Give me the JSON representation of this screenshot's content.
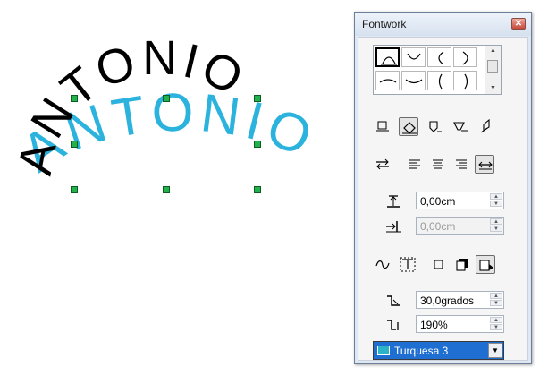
{
  "canvas": {
    "shadow_text": "ANTONIO",
    "main_text": "ANTONIO",
    "shadow_color": "#2bb3dd",
    "text_color": "#000000",
    "handle_color": "#22b14c"
  },
  "window": {
    "title": "Fontwork",
    "close_glyph": "✕"
  },
  "gallery": {
    "shapes": [
      "upper-arc",
      "lower-arc",
      "left-arc",
      "right-arc",
      "upper-arc-open",
      "lower-arc-open",
      "left-arc-open",
      "right-arc-open"
    ],
    "selected_index": 0,
    "scroll_up": "▲",
    "scroll_down": "▼"
  },
  "toolbar_orientation": {
    "buttons": [
      "off-icon",
      "rotate-icon",
      "upright-icon",
      "slant-horizontal-icon",
      "slant-vertical-icon"
    ],
    "active": "rotate-icon"
  },
  "toolbar_alignment": {
    "buttons": [
      "orientation-icon",
      "align-left-icon",
      "align-center-icon",
      "align-right-icon",
      "autosize-icon"
    ],
    "active": "autosize-icon"
  },
  "distance": {
    "value": "0,00cm"
  },
  "indent": {
    "value": "0,00cm",
    "disabled": true
  },
  "toolbar_contour": {
    "buttons": [
      "contour-icon",
      "text-frame-icon",
      "shadow-off-icon",
      "shadow-vertical-icon",
      "shadow-slant-icon"
    ],
    "active": "shadow-slant-icon"
  },
  "shadow_angle": {
    "value": "30,0grados"
  },
  "shadow_size": {
    "value": "190%"
  },
  "shadow_color": {
    "label": "Turquesa 3",
    "swatch": "#2bb3c8",
    "drop_glyph": "▼"
  }
}
